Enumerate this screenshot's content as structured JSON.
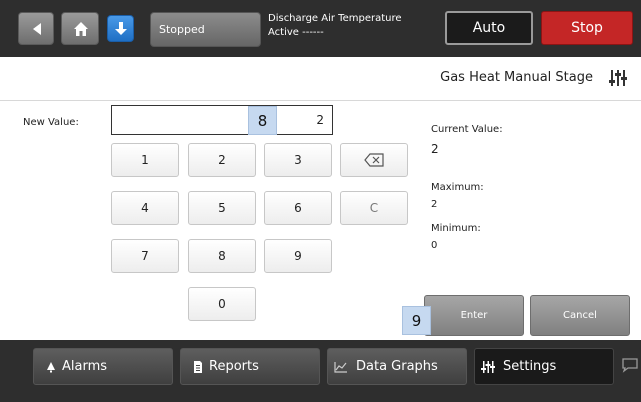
{
  "header": {
    "status": "Stopped",
    "point_name": "Discharge Air Temperature",
    "point_state": "Active ------",
    "mode_button": "Auto",
    "stop_button": "Stop"
  },
  "page": {
    "title": "Gas Heat Manual Stage"
  },
  "entry": {
    "label": "New Value:",
    "value": "2"
  },
  "keypad": {
    "keys": [
      "1",
      "2",
      "3",
      "4",
      "5",
      "6",
      "7",
      "8",
      "9",
      "0"
    ],
    "clear": "C"
  },
  "info": {
    "current_label": "Current Value:",
    "current_value": "2",
    "max_label": "Maximum:",
    "max_value": "2",
    "min_label": "Minimum:",
    "min_value": "0"
  },
  "actions": {
    "enter": "Enter",
    "cancel": "Cancel"
  },
  "callouts": [
    "8",
    "9"
  ],
  "nav": [
    {
      "label": "Alarms",
      "icon": "bell-icon"
    },
    {
      "label": "Reports",
      "icon": "document-icon"
    },
    {
      "label": "Data Graphs",
      "icon": "chart-icon"
    },
    {
      "label": "Settings",
      "icon": "settings-sliders-icon",
      "active": true
    }
  ],
  "colors": {
    "bar_bg": "#2e2e2e",
    "stop_red": "#c42626",
    "download_blue": "#1f6fc4",
    "callout_bg": "#c6d9f0"
  }
}
